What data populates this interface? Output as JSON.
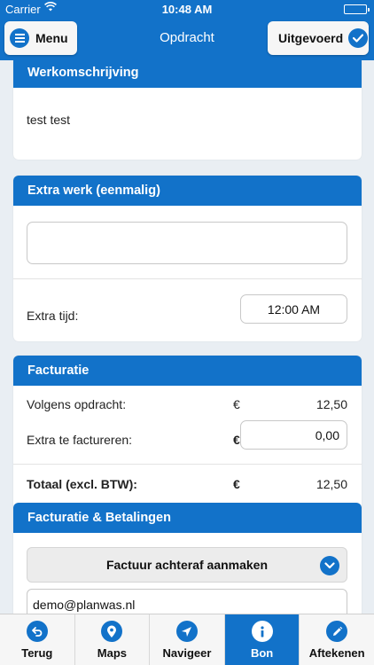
{
  "status_bar": {
    "carrier": "Carrier",
    "time": "10:48 AM"
  },
  "nav": {
    "title": "Opdracht",
    "menu_label": "Menu",
    "done_label": "Uitgevoerd"
  },
  "werk": {
    "title": "Werkomschrijving",
    "text": "test test"
  },
  "extra": {
    "title": "Extra werk (eenmalig)",
    "textarea_value": "",
    "time_label": "Extra tijd:",
    "time_value": "12:00 AM"
  },
  "facturatie": {
    "title": "Facturatie",
    "rows": [
      {
        "label": "Volgens opdracht:",
        "currency": "€",
        "value": "12,50"
      },
      {
        "label": "Extra te factureren:",
        "currency": "€",
        "value": "0,00"
      }
    ],
    "total": {
      "label": "Totaal (excl. BTW):",
      "currency": "€",
      "value": "12,50"
    }
  },
  "betalingen": {
    "title": "Facturatie & Betalingen",
    "select_value": "Factuur achteraf aanmaken",
    "email": "demo@planwas.nl"
  },
  "tabs": [
    {
      "label": "Terug",
      "icon": "back-arrow-icon"
    },
    {
      "label": "Maps",
      "icon": "map-pin-icon"
    },
    {
      "label": "Navigeer",
      "icon": "navigate-arrow-icon"
    },
    {
      "label": "Bon",
      "icon": "info-icon",
      "active": true
    },
    {
      "label": "Aftekenen",
      "icon": "pencil-icon"
    }
  ],
  "colors": {
    "brand": "#1272c9",
    "background": "#e9eef3"
  }
}
